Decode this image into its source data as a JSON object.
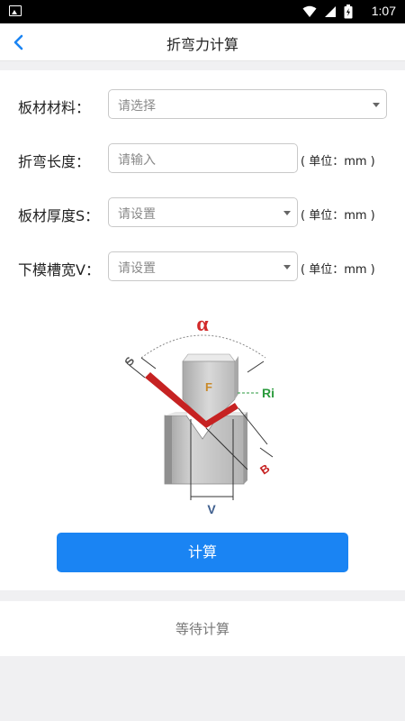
{
  "status_bar": {
    "time": "1:07"
  },
  "nav": {
    "title": "折弯力计算"
  },
  "form": {
    "material": {
      "label": "板材材料：",
      "placeholder": "请选择"
    },
    "length": {
      "label": "折弯长度：",
      "placeholder": "请输入",
      "unit": "( 单位：mm )"
    },
    "thickness": {
      "label": "板材厚度S：",
      "placeholder": "请设置",
      "unit": "( 单位：mm )"
    },
    "die_width": {
      "label": "下模槽宽V：",
      "placeholder": "请设置",
      "unit": "( 单位：mm )"
    }
  },
  "diagram": {
    "alpha": "α",
    "s": "S",
    "f": "F",
    "ri": "Ri",
    "b": "B",
    "v": "V",
    "colors": {
      "alpha": "#d22a2a",
      "sheet": "#c62222",
      "ri": "#2a9a3c",
      "f": "#c98a2a",
      "v": "#3f5f8e"
    }
  },
  "actions": {
    "calculate_label": "计算"
  },
  "result": {
    "text": "等待计算"
  }
}
